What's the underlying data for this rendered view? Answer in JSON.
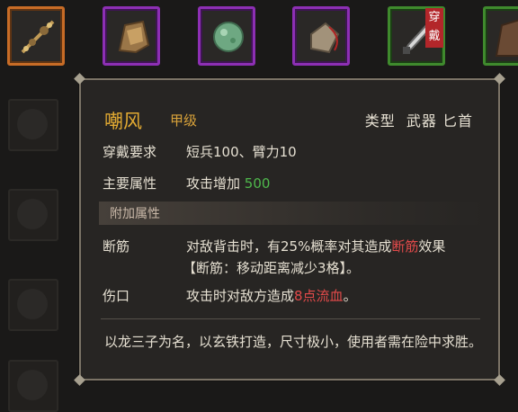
{
  "top_slots": [
    {
      "name": "staff-icon",
      "quality": "orange"
    },
    {
      "name": "armor-icon",
      "quality": "purple"
    },
    {
      "name": "jade-icon",
      "quality": "purple"
    },
    {
      "name": "pouch-icon",
      "quality": "purple"
    },
    {
      "name": "dagger-icon",
      "quality": "green",
      "wear_tag": "穿戴"
    },
    {
      "name": "robe-icon",
      "quality": "green"
    }
  ],
  "item": {
    "name": "嘲风",
    "grade": "甲级",
    "type_label": "类型",
    "type_value": "武器 匕首",
    "requirement_label": "穿戴要求",
    "requirement_value": "短兵100、臂力10",
    "main_attr_label": "主要属性",
    "main_attr_text": "攻击增加",
    "main_attr_value": "500",
    "extra_header": "附加属性",
    "effects": [
      {
        "name": "断筋",
        "line1_a": "对敌背击时，有25%概率对其造成",
        "line1_b": "断筋",
        "line1_c": "效果",
        "line2": "【断筋：移动距离减少3格】。"
      },
      {
        "name": "伤口",
        "line1_a": "攻击时对敌方造成",
        "line1_b": "8点流血",
        "line1_c": "。",
        "line2": ""
      }
    ],
    "description": "以龙三子为名，以玄铁打造，尺寸极小，使用者需在险中求胜。"
  },
  "colors": {
    "orange": "#c86c26",
    "purple": "#8d2fb4",
    "green": "#3f8a2d",
    "gold": "#e2aa32",
    "attr_green": "#4fb84c",
    "debuff_red": "#e24a4a"
  }
}
